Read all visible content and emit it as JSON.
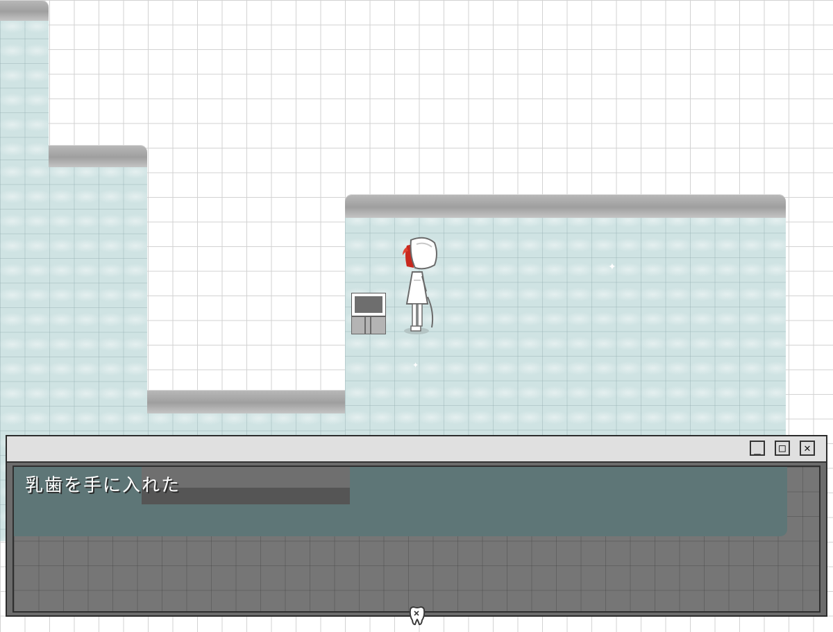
{
  "map": {
    "icons": {
      "terminal": "computer-terminal-icon",
      "sparkle": "sparkle-icon",
      "tooth": "baby-tooth-icon"
    },
    "colors": {
      "ice": "#cfe3e3",
      "ledge": "#a8a8a8",
      "grid": "#d2d2d2"
    }
  },
  "dialog": {
    "message": "乳歯を手に入れた",
    "minimize_icon": "_",
    "maximize_icon": "□",
    "close_icon": "✕"
  }
}
